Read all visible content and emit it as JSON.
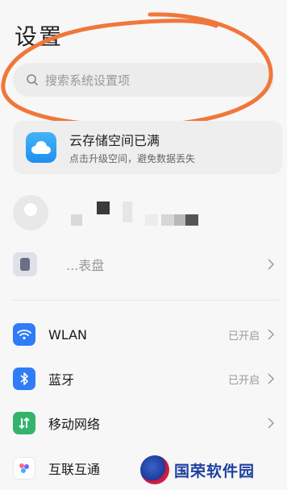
{
  "page": {
    "title": "设置"
  },
  "search": {
    "placeholder": "搜索系统设置项"
  },
  "cloud_card": {
    "title": "云存储空间已满",
    "subtitle": "点击升级空间，避免数据丢失"
  },
  "partial_row": {
    "label": "...表盘"
  },
  "settings": [
    {
      "label": "WLAN",
      "status": "已开启",
      "icon": "wifi-icon",
      "color": "#2f7cf6"
    },
    {
      "label": "蓝牙",
      "status": "已开启",
      "icon": "bluetooth-icon",
      "color": "#2f7cf6"
    },
    {
      "label": "移动网络",
      "status": "",
      "icon": "mobile-network-icon",
      "color": "#34b36a"
    },
    {
      "label": "互联互通",
      "status": "",
      "icon": "connectivity-icon",
      "color": "#ffffff"
    }
  ],
  "watermark": {
    "text": "国荣软件园"
  },
  "colors": {
    "annotation": "#f0773a",
    "accent_blue": "#2f7cf6",
    "accent_green": "#34b36a"
  }
}
